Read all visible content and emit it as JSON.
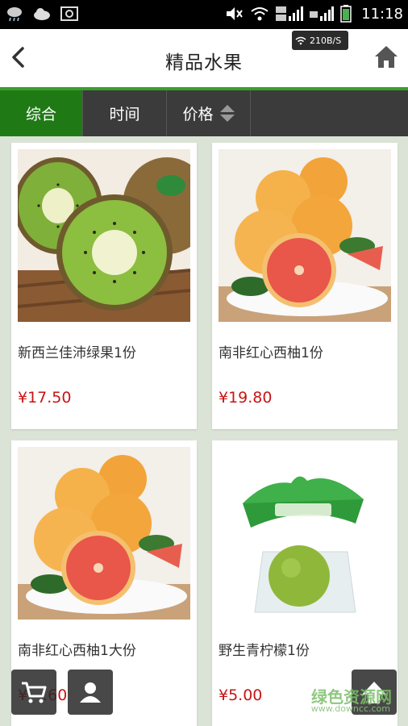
{
  "status_bar": {
    "time": "11:18",
    "network_speed": "210B/S",
    "icons": [
      "weather-icon",
      "cloud-icon",
      "screenshot-icon",
      "mute-icon",
      "wifi-icon",
      "4g-signal-icon",
      "2g-signal-icon",
      "battery-icon"
    ]
  },
  "header": {
    "title": "精品水果",
    "back_icon": "chevron-left-icon",
    "home_icon": "home-icon"
  },
  "tabs": [
    {
      "label": "综合",
      "active": true
    },
    {
      "label": "时间",
      "active": false
    },
    {
      "label": "价格",
      "active": false,
      "icon": "sort-icon"
    }
  ],
  "products": [
    {
      "name": "新西兰佳沛绿果1份",
      "price": "¥17.50",
      "image": "kiwi"
    },
    {
      "name": "南非红心西柚1份",
      "price": "¥19.80",
      "image": "grapefruit"
    },
    {
      "name": "南非红心西柚1大份",
      "price": "¥—.60",
      "image": "grapefruit"
    },
    {
      "name": "野生青柠檬1份",
      "price": "¥5.00",
      "image": "lime"
    }
  ],
  "floating_buttons": {
    "cart_icon": "cart-icon",
    "user_icon": "user-icon",
    "top_icon": "arrow-up-icon"
  },
  "watermark": {
    "text": "绿色资源网",
    "url": "www.downcc.com"
  },
  "colors": {
    "accent_green": "#1f7a16",
    "header_line": "#3a9e2b",
    "price_red": "#c81515",
    "tab_bar": "#3b3b3b"
  }
}
